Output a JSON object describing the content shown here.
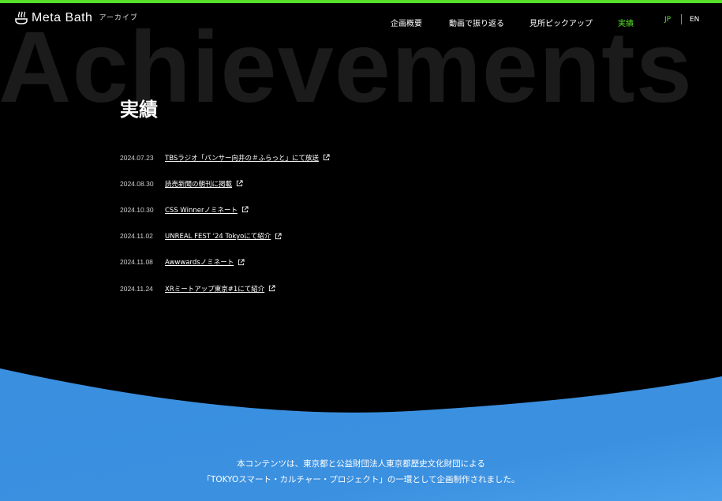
{
  "brand": {
    "logo_text": "Meta Bath",
    "sub_label": "アーカイブ"
  },
  "nav": {
    "items": [
      {
        "label": "企画概要"
      },
      {
        "label": "動画で振り返る"
      },
      {
        "label": "見所ピックアップ"
      },
      {
        "label": "実績"
      }
    ],
    "active_index": 3,
    "lang": {
      "jp": "JP",
      "en": "EN",
      "active": "JP"
    }
  },
  "hero": {
    "background_word": "Achievements",
    "title": "実績"
  },
  "news": [
    {
      "date": "2024.07.23",
      "text": "TBSラジオ「パンサー向井の＃ふらっと」にて放送"
    },
    {
      "date": "2024.08.30",
      "text": "読売新聞の朝刊に掲載"
    },
    {
      "date": "2024.10.30",
      "text": "CSS Winnerノミネート"
    },
    {
      "date": "2024.11.02",
      "text": "UNREAL FEST '24 Tokyoにて紹介"
    },
    {
      "date": "2024.11.08",
      "text": "Awwwardsノミネート"
    },
    {
      "date": "2024.11.24",
      "text": "XRミートアップ東京#1にて紹介"
    }
  ],
  "footer": {
    "line1": "本コンテンツは、東京都と公益財団法人東京都歴史文化財団による",
    "line2": "「TOKYOスマート・カルチャー・プロジェクト」の一環として企画制作されました。"
  },
  "icons": {
    "logo": "bath-steam-icon",
    "external": "external-link-icon"
  },
  "colors": {
    "accent": "#56e02a",
    "background": "#000000",
    "wave": "#3a8fdf",
    "bg_word": "#1b1b1b"
  }
}
